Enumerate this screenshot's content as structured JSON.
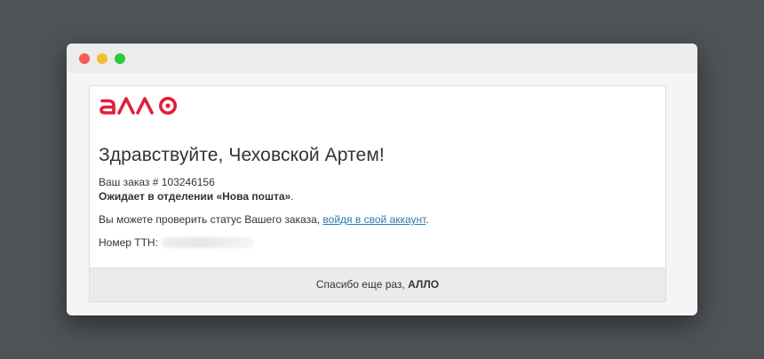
{
  "window": {
    "traffic_lights": [
      "close",
      "minimize",
      "zoom"
    ]
  },
  "brand": {
    "logo_text": "АЛЛО",
    "color": "#e31e3b"
  },
  "email": {
    "greeting": "Здравствуйте, Чеховской Артем!",
    "order_prefix": "Ваш заказ # ",
    "order_number": "103246156",
    "status_text": "Ожидает в отделении «Нова пошта»",
    "status_end": ".",
    "check_text": "Вы можете проверить статус Вашего заказа, ",
    "check_link": "войдя в свой аккаунт",
    "check_end": ".",
    "ttn_label": "Номер ТТН:"
  },
  "footer": {
    "text": "Спасибо еще раз, ",
    "brand": "АЛЛО"
  }
}
